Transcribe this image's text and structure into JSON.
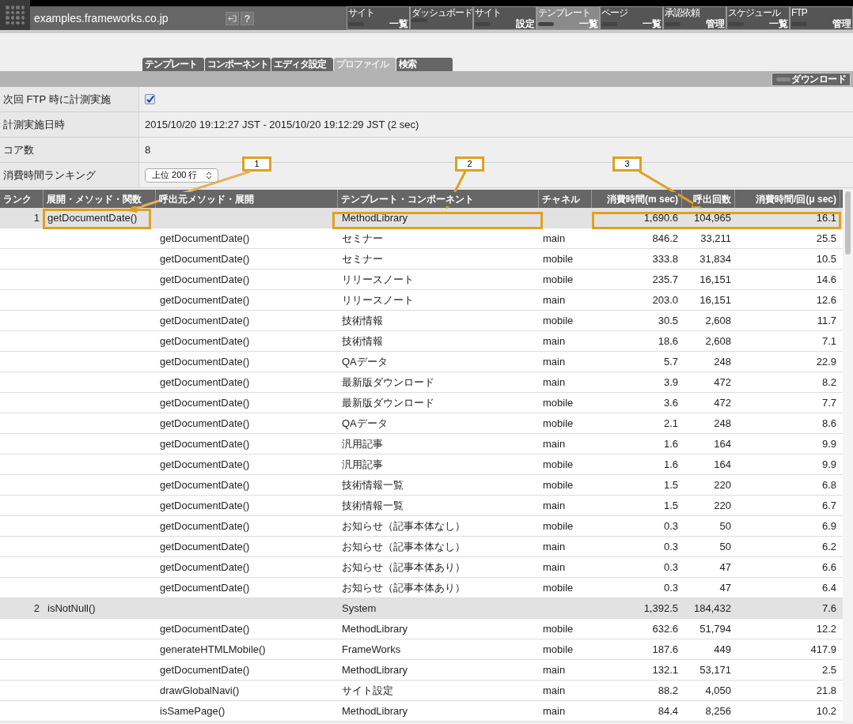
{
  "header": {
    "site": "examples.frameworks.co.jp",
    "help": "?"
  },
  "nav": [
    {
      "top": "サイト",
      "bottom": "一覧",
      "selected": false
    },
    {
      "top": "ダッシュボード",
      "selected": false
    },
    {
      "top": "サイト",
      "bottom": "設定",
      "selected": false
    },
    {
      "top": "テンプレート",
      "bottom": "一覧",
      "selected": true
    },
    {
      "top": "ページ",
      "bottom": "一覧",
      "selected": false
    },
    {
      "top": "承認依頼",
      "bottom": "管理",
      "selected": false
    },
    {
      "top": "スケジュール",
      "bottom": "一覧",
      "selected": false
    },
    {
      "top": "FTP",
      "bottom": "管理",
      "selected": false
    }
  ],
  "tabs": [
    {
      "label": "テンプレート",
      "selected": false
    },
    {
      "label": "コンポーネント",
      "selected": false
    },
    {
      "label": "エディタ設定",
      "selected": false
    },
    {
      "label": "プロファイル",
      "selected": true
    },
    {
      "label": "検索",
      "selected": false
    }
  ],
  "download_button": "ダウンロード",
  "settings": [
    {
      "kind": "checkbox",
      "label": "次回 FTP 時に計測実施",
      "checked": true
    },
    {
      "kind": "text",
      "label": "計測実施日時",
      "value": "2015/10/20 19:12:27 JST - 2015/10/20 19:12:29 JST (2 sec)"
    },
    {
      "kind": "text",
      "label": "コア数",
      "value": "8"
    },
    {
      "kind": "select",
      "label": "消費時間ランキング",
      "value": "上位 200 行"
    }
  ],
  "table": {
    "columns": [
      "ランク",
      "展開・メソッド・関数",
      "呼出元メソッド・展開",
      "テンプレート・コンポーネント",
      "チャネル",
      "消費時間(m sec)",
      "呼出回数",
      "消費時間/回(μ sec)"
    ],
    "rows": [
      {
        "kind": "group",
        "rank": "1",
        "method": "getDocumentDate()",
        "template": "MethodLibrary",
        "time": "1,690.6",
        "count": "104,965",
        "per": "16.1"
      },
      {
        "kind": "call",
        "caller": "getDocumentDate()",
        "template": "セミナー",
        "channel": "main",
        "time": "846.2",
        "count": "33,211",
        "per": "25.5"
      },
      {
        "kind": "call",
        "caller": "getDocumentDate()",
        "template": "セミナー",
        "channel": "mobile",
        "time": "333.8",
        "count": "31,834",
        "per": "10.5"
      },
      {
        "kind": "call",
        "caller": "getDocumentDate()",
        "template": "リリースノート",
        "channel": "mobile",
        "time": "235.7",
        "count": "16,151",
        "per": "14.6"
      },
      {
        "kind": "call",
        "caller": "getDocumentDate()",
        "template": "リリースノート",
        "channel": "main",
        "time": "203.0",
        "count": "16,151",
        "per": "12.6"
      },
      {
        "kind": "call",
        "caller": "getDocumentDate()",
        "template": "技術情報",
        "channel": "mobile",
        "time": "30.5",
        "count": "2,608",
        "per": "11.7"
      },
      {
        "kind": "call",
        "caller": "getDocumentDate()",
        "template": "技術情報",
        "channel": "main",
        "time": "18.6",
        "count": "2,608",
        "per": "7.1"
      },
      {
        "kind": "call",
        "caller": "getDocumentDate()",
        "template": "QAデータ",
        "channel": "main",
        "time": "5.7",
        "count": "248",
        "per": "22.9"
      },
      {
        "kind": "call",
        "caller": "getDocumentDate()",
        "template": "最新版ダウンロード",
        "channel": "main",
        "time": "3.9",
        "count": "472",
        "per": "8.2"
      },
      {
        "kind": "call",
        "caller": "getDocumentDate()",
        "template": "最新版ダウンロード",
        "channel": "mobile",
        "time": "3.6",
        "count": "472",
        "per": "7.7"
      },
      {
        "kind": "call",
        "caller": "getDocumentDate()",
        "template": "QAデータ",
        "channel": "mobile",
        "time": "2.1",
        "count": "248",
        "per": "8.6"
      },
      {
        "kind": "call",
        "caller": "getDocumentDate()",
        "template": "汎用記事",
        "channel": "main",
        "time": "1.6",
        "count": "164",
        "per": "9.9"
      },
      {
        "kind": "call",
        "caller": "getDocumentDate()",
        "template": "汎用記事",
        "channel": "mobile",
        "time": "1.6",
        "count": "164",
        "per": "9.9"
      },
      {
        "kind": "call",
        "caller": "getDocumentDate()",
        "template": "技術情報一覧",
        "channel": "mobile",
        "time": "1.5",
        "count": "220",
        "per": "6.8"
      },
      {
        "kind": "call",
        "caller": "getDocumentDate()",
        "template": "技術情報一覧",
        "channel": "main",
        "time": "1.5",
        "count": "220",
        "per": "6.7"
      },
      {
        "kind": "call",
        "caller": "getDocumentDate()",
        "template": "お知らせ（記事本体なし）",
        "channel": "mobile",
        "time": "0.3",
        "count": "50",
        "per": "6.9"
      },
      {
        "kind": "call",
        "caller": "getDocumentDate()",
        "template": "お知らせ（記事本体なし）",
        "channel": "main",
        "time": "0.3",
        "count": "50",
        "per": "6.2"
      },
      {
        "kind": "call",
        "caller": "getDocumentDate()",
        "template": "お知らせ（記事本体あり）",
        "channel": "main",
        "time": "0.3",
        "count": "47",
        "per": "6.6"
      },
      {
        "kind": "call",
        "caller": "getDocumentDate()",
        "template": "お知らせ（記事本体あり）",
        "channel": "mobile",
        "time": "0.3",
        "count": "47",
        "per": "6.4"
      },
      {
        "kind": "group",
        "rank": "2",
        "method": "isNotNull()",
        "template": "System",
        "time": "1,392.5",
        "count": "184,432",
        "per": "7.6"
      },
      {
        "kind": "call",
        "caller": "getDocumentDate()",
        "template": "MethodLibrary",
        "channel": "mobile",
        "time": "632.6",
        "count": "51,794",
        "per": "12.2"
      },
      {
        "kind": "call",
        "caller": "generateHTMLMobile()",
        "template": "FrameWorks",
        "channel": "mobile",
        "time": "187.6",
        "count": "449",
        "per": "417.9"
      },
      {
        "kind": "call",
        "caller": "getDocumentDate()",
        "template": "MethodLibrary",
        "channel": "main",
        "time": "132.1",
        "count": "53,171",
        "per": "2.5"
      },
      {
        "kind": "call",
        "caller": "drawGlobalNavi()",
        "template": "サイト設定",
        "channel": "main",
        "time": "88.2",
        "count": "4,050",
        "per": "21.8"
      },
      {
        "kind": "call",
        "caller": "isSamePage()",
        "template": "MethodLibrary",
        "channel": "main",
        "time": "84.4",
        "count": "8,256",
        "per": "10.2"
      }
    ]
  },
  "callouts": [
    "1",
    "2",
    "3"
  ]
}
